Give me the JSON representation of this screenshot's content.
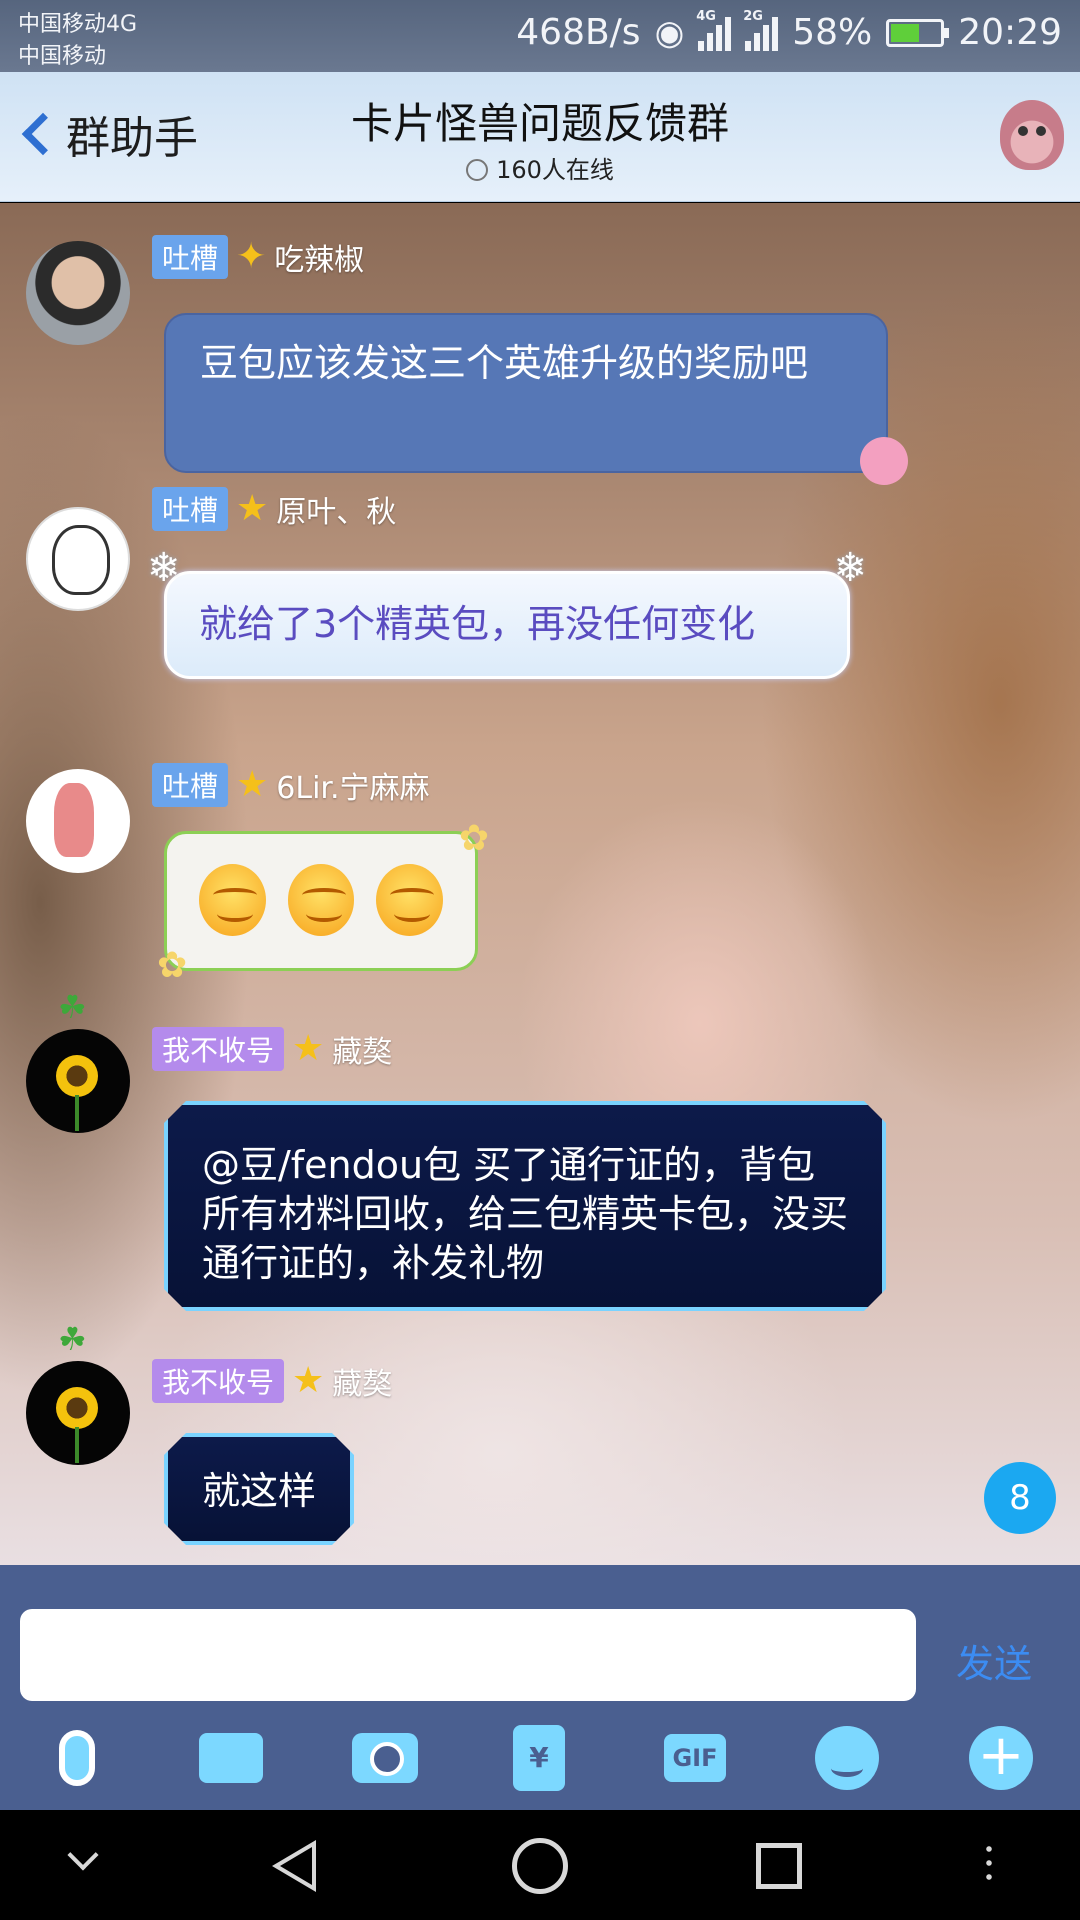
{
  "status_bar": {
    "carrier_top": "中国移动4G",
    "carrier_bottom": "中国移动",
    "net_speed": "468B/s",
    "sim1_label": "4G",
    "sim2_label": "2G",
    "battery": "58%",
    "battery_level": 0.58,
    "time": "20:29"
  },
  "header": {
    "back_label": "群助手",
    "title": "卡片怪兽问题反馈群",
    "online": "160人在线"
  },
  "messages": [
    {
      "badge": "吐槽",
      "badge_color": "#6aa4ec",
      "name": "吃辣椒",
      "text": "豆包应该发这三个英雄升级的奖励吧"
    },
    {
      "badge": "吐槽",
      "badge_color": "#6aa4ec",
      "name": "原叶、秋",
      "text": "就给了3个精英包，再没任何变化"
    },
    {
      "badge": "吐槽",
      "badge_color": "#6aa4ec",
      "name": "6Lir.宁麻麻",
      "emoji_count": 3
    },
    {
      "badge": "我不收号",
      "badge_color": "#b48bec",
      "name": "藏獒",
      "text": "@豆/fendou包 买了通行证的，背包所有材料回收，给三包精英卡包，没买通行证的，补发礼物"
    },
    {
      "badge": "我不收号",
      "badge_color": "#b48bec",
      "name": "藏獒",
      "text": "就这样"
    }
  ],
  "unread_count": "8",
  "composer": {
    "send_label": "发送",
    "red_packet_symbol": "¥",
    "gif_label": "GIF"
  },
  "colors": {
    "accent": "#3c8cf2",
    "input_bar": "#4a5f90",
    "unread_badge": "#1ba8f1"
  }
}
